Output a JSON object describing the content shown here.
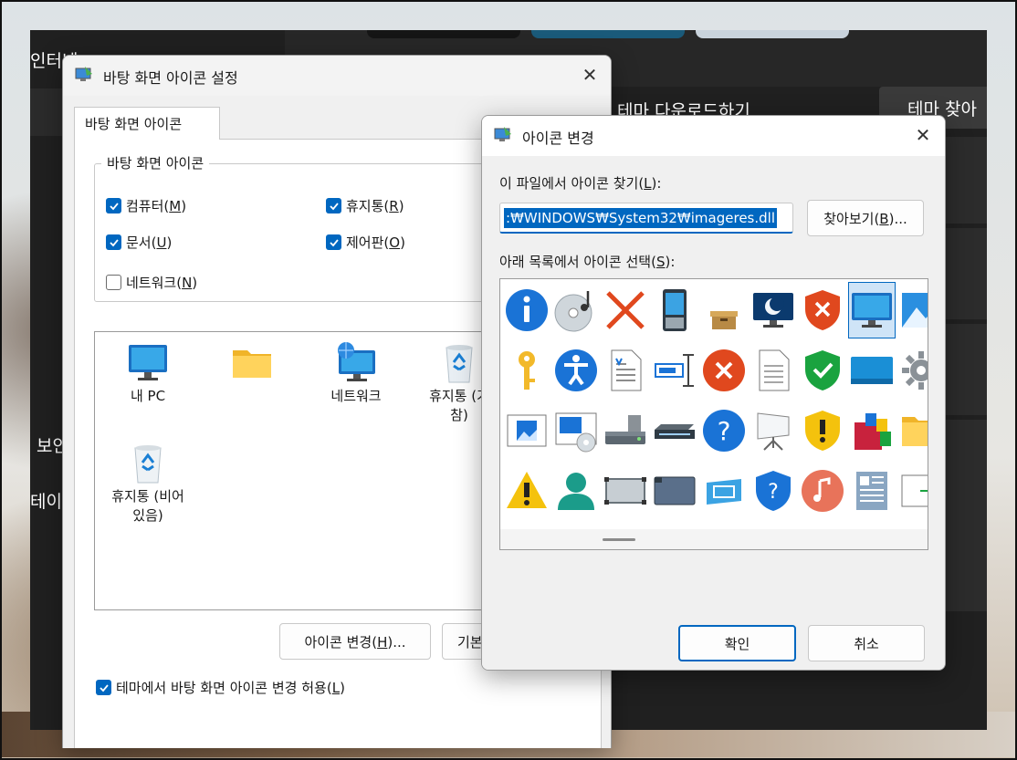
{
  "background": {
    "left_text_1": "인터넷",
    "left_text_2": "보안",
    "left_text_3": "테이",
    "theme_download_text": "테마 다운로드하기",
    "theme_browse_button": "테마 찾아"
  },
  "desktop_icons_dialog": {
    "title": "바탕 화면 아이콘 설정",
    "tab_label": "바탕 화면 아이콘",
    "group_title": "바탕 화면 아이콘",
    "checkboxes": [
      {
        "text": "컴퓨터",
        "mnemonic": "M",
        "checked": true
      },
      {
        "text": "휴지통",
        "mnemonic": "R",
        "checked": true
      },
      {
        "text": "문서",
        "mnemonic": "U",
        "checked": true
      },
      {
        "text": "제어판",
        "mnemonic": "O",
        "checked": true
      },
      {
        "text": "네트워크",
        "mnemonic": "N",
        "checked": false
      }
    ],
    "icons": [
      {
        "label": "내 PC",
        "icon": "monitor-icon"
      },
      {
        "label": "",
        "icon": "folder-icon"
      },
      {
        "label": "네트워크",
        "icon": "network-icon"
      },
      {
        "label": "휴지통 (가\n참)",
        "icon": "recycle-bin-full-icon"
      },
      {
        "label": "휴지통 (비어\n있음)",
        "icon": "recycle-bin-empty-icon"
      }
    ],
    "change_icon_button": {
      "text": "아이콘 변경",
      "mnemonic": "H",
      "suffix": "..."
    },
    "restore_button": {
      "text": "기본"
    },
    "allow_theme_checkbox": {
      "text": "테마에서 바탕 화면 아이콘 변경 허용",
      "mnemonic": "L",
      "checked": true
    }
  },
  "change_icon_dialog": {
    "title": "아이콘 변경",
    "find_label": {
      "text": "이 파일에서 아이콘 찾기",
      "mnemonic": "L",
      "suffix": ":"
    },
    "path_value": ":₩WINDOWS₩System32₩imageres.dll",
    "browse_button": {
      "text": "찾아보기",
      "mnemonic": "B",
      "suffix": "..."
    },
    "select_label": {
      "text": "아래 목록에서 아이콘 선택",
      "mnemonic": "S",
      "suffix": ":"
    },
    "ok_button": "확인",
    "cancel_button": "취소",
    "grid_icons": [
      "info-icon",
      "cd-music-icon",
      "red-x-icon",
      "pda-icon",
      "small-box-icon",
      "moon-monitor-icon",
      "shield-x-icon",
      "monitor-icon",
      "picture-icon",
      "key-icon",
      "accessibility-icon",
      "text-document-icon",
      "text-cursor-icon",
      "error-icon",
      "blank-document-icon",
      "shield-check-icon",
      "wide-screen-icon",
      "gear-icon",
      "image-frame-icon",
      "media-window-icon",
      "drive-icon",
      "scanner-icon",
      "help-icon",
      "projector-icon",
      "shield-warning-icon",
      "installer-box-icon",
      "folder-icon",
      "warning-icon",
      "user-icon",
      "grey-panel-icon",
      "card-icon",
      "blue-box-icon",
      "shield-help-icon",
      "music-note-icon",
      "news-icon",
      "arrow-window-icon"
    ]
  }
}
